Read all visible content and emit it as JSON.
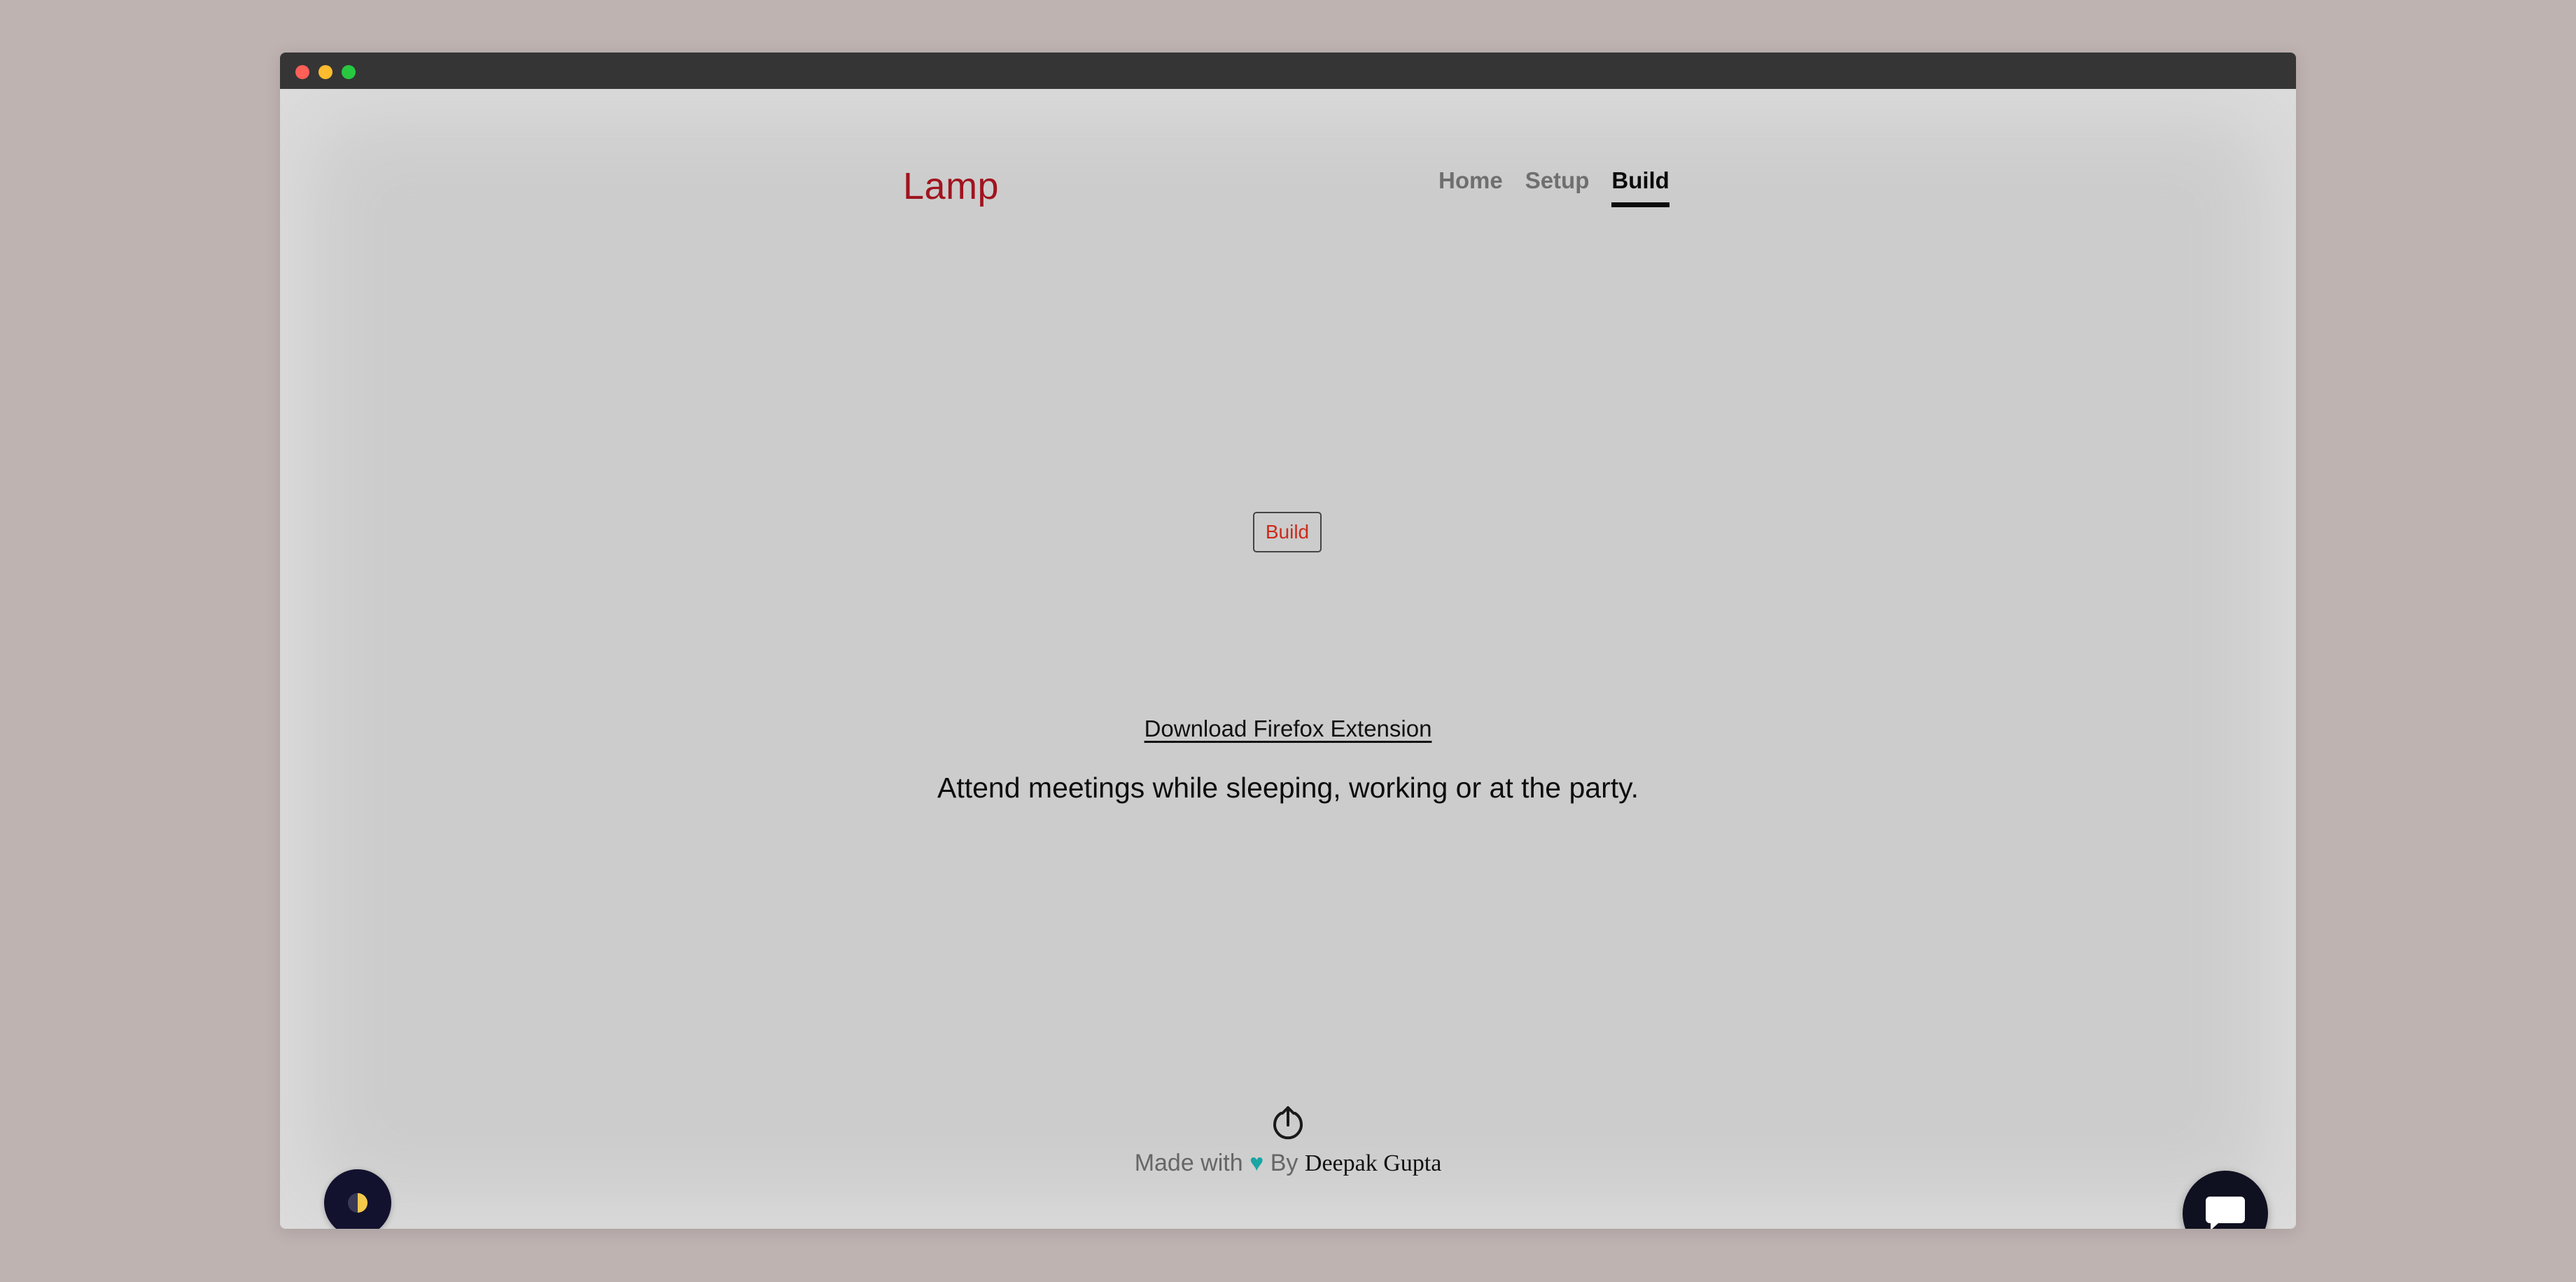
{
  "header": {
    "brand": "Lamp",
    "nav": [
      "Home",
      "Setup",
      "Build"
    ],
    "active_tab": "Build"
  },
  "main": {
    "build_button_label": "Build",
    "extension_link": "Download Firefox Extension",
    "tagline": "Attend meetings while sleeping, working or at the party."
  },
  "footer": {
    "made_with": "Made with",
    "heart": "♥",
    "by": "By",
    "author": "Deepak Gupta"
  },
  "icons": {
    "power": "power-upload-icon",
    "theme": "half-moon-icon",
    "chat": "chat-bubble-icon"
  },
  "colors": {
    "brand": "#a0141f",
    "build_text": "#cc2a1a",
    "heart": "#1aa5a5",
    "page_background": "#cccccc",
    "floating_button": "#12122f"
  }
}
